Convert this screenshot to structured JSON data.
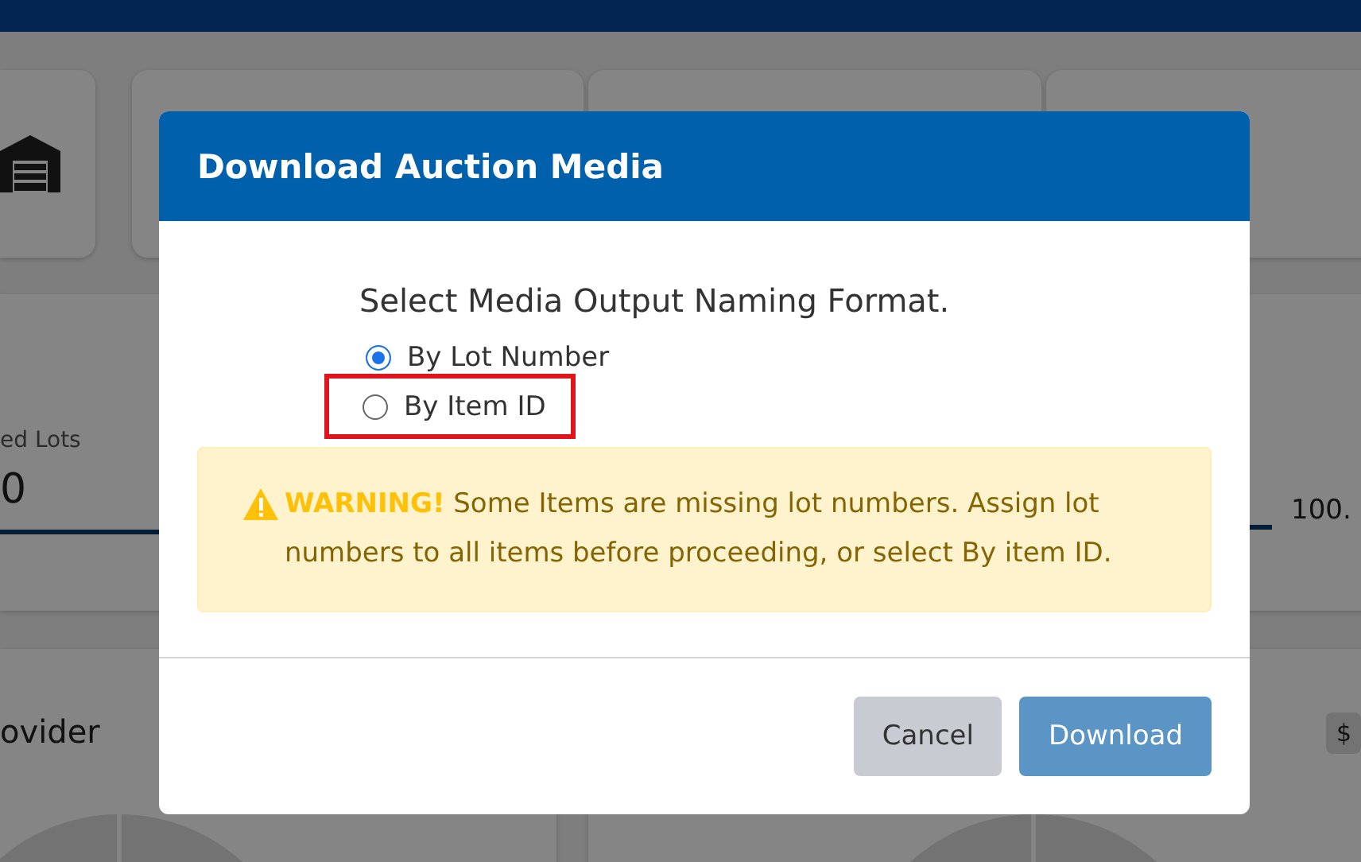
{
  "background": {
    "lots_label": "ed Lots",
    "lots_value": "0",
    "percent": "100.",
    "panel_title": "ovider",
    "amount_badge": "$"
  },
  "dialog": {
    "title": "Download Auction Media",
    "heading": "Select Media Output Naming Format.",
    "options": [
      {
        "label": "By Lot Number",
        "selected": true,
        "highlighted": false
      },
      {
        "label": "By Item ID",
        "selected": false,
        "highlighted": true
      }
    ],
    "alert": {
      "kind": "warning",
      "title": "WARNING!",
      "message": "Some Items are missing lot numbers. Assign lot numbers to all items before proceeding, or select By item ID."
    },
    "buttons": [
      {
        "label": "Cancel",
        "kind": "secondary"
      },
      {
        "label": "Download",
        "kind": "primary"
      }
    ]
  }
}
